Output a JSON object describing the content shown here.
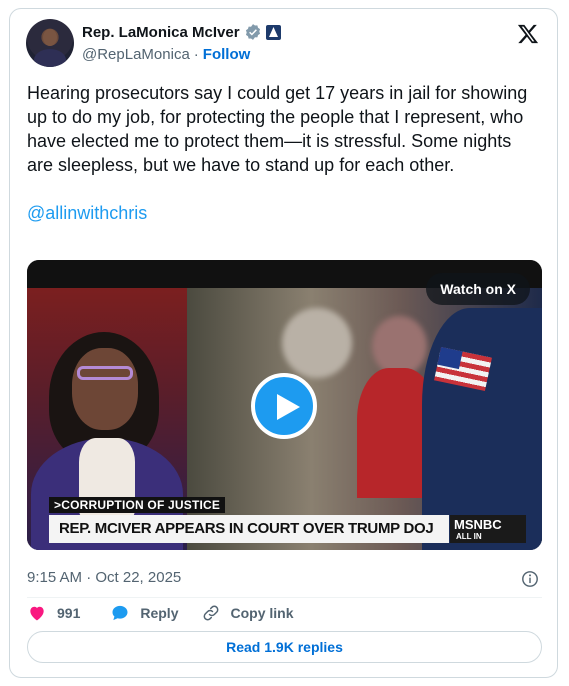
{
  "author": {
    "name": "Rep. LaMonica McIver",
    "handle": "@RepLaMonica",
    "separator": "·",
    "follow_label": "Follow"
  },
  "tweet": {
    "text": "Hearing prosecutors say I could get 17 years in jail for showing up to do my job, for protecting the people that I represent, who have elected me to protect them—it is stressful. Some nights are sleepless, but we have to stand up for each other.",
    "mention": "@allinwithchris"
  },
  "media": {
    "watch_label": "Watch on X",
    "chyron_top": ">CORRUPTION OF JUSTICE",
    "chyron_main": "REP. MCIVER APPEARS IN COURT OVER TRUMP DOJ CHARGES",
    "network": "MSNBC",
    "show": "ALL IN"
  },
  "meta": {
    "timestamp": "9:15 AM · Oct 22, 2025"
  },
  "actions": {
    "like_count": "991",
    "reply_label": "Reply",
    "copy_label": "Copy link",
    "read_replies": "Read 1.9K replies"
  },
  "colors": {
    "accent": "#1d9bf0",
    "link": "#006fd6",
    "like": "#f91880",
    "muted": "#536471"
  },
  "icons": [
    "verified-badge-icon",
    "government-affiliation-icon",
    "x-logo-icon",
    "play-icon",
    "info-icon",
    "heart-icon",
    "reply-bubble-icon",
    "link-icon"
  ]
}
